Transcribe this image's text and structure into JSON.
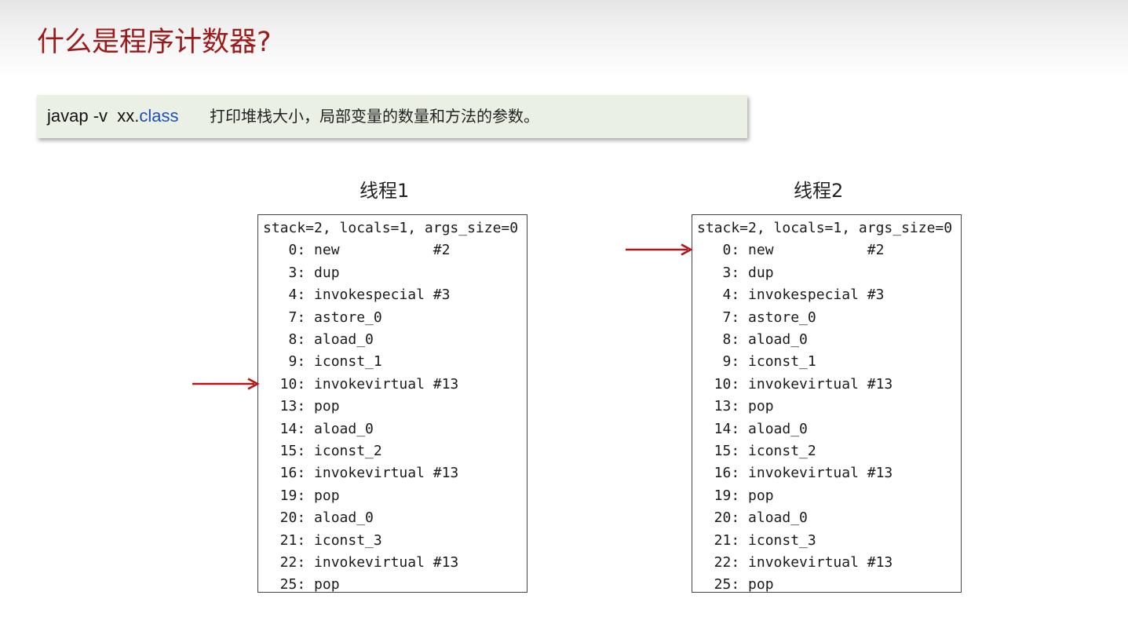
{
  "slide": {
    "title": "什么是程序计数器?"
  },
  "command": {
    "tool": "javap -v  xx.",
    "ext": "class",
    "description": "打印堆栈大小，局部变量的数量和方法的参数。"
  },
  "panels": [
    {
      "title": "线程1",
      "header": "stack=2, locals=1, args_size=0",
      "pointer_offset": "10",
      "lines": [
        {
          "offset": "0",
          "instr": "new           #2"
        },
        {
          "offset": "3",
          "instr": "dup"
        },
        {
          "offset": "4",
          "instr": "invokespecial #3"
        },
        {
          "offset": "7",
          "instr": "astore_0"
        },
        {
          "offset": "8",
          "instr": "aload_0"
        },
        {
          "offset": "9",
          "instr": "iconst_1"
        },
        {
          "offset": "10",
          "instr": "invokevirtual #13"
        },
        {
          "offset": "13",
          "instr": "pop"
        },
        {
          "offset": "14",
          "instr": "aload_0"
        },
        {
          "offset": "15",
          "instr": "iconst_2"
        },
        {
          "offset": "16",
          "instr": "invokevirtual #13"
        },
        {
          "offset": "19",
          "instr": "pop"
        },
        {
          "offset": "20",
          "instr": "aload_0"
        },
        {
          "offset": "21",
          "instr": "iconst_3"
        },
        {
          "offset": "22",
          "instr": "invokevirtual #13"
        },
        {
          "offset": "25",
          "instr": "pop"
        }
      ]
    },
    {
      "title": "线程2",
      "header": "stack=2, locals=1, args_size=0",
      "pointer_offset": "0",
      "lines": [
        {
          "offset": "0",
          "instr": "new           #2"
        },
        {
          "offset": "3",
          "instr": "dup"
        },
        {
          "offset": "4",
          "instr": "invokespecial #3"
        },
        {
          "offset": "7",
          "instr": "astore_0"
        },
        {
          "offset": "8",
          "instr": "aload_0"
        },
        {
          "offset": "9",
          "instr": "iconst_1"
        },
        {
          "offset": "10",
          "instr": "invokevirtual #13"
        },
        {
          "offset": "13",
          "instr": "pop"
        },
        {
          "offset": "14",
          "instr": "aload_0"
        },
        {
          "offset": "15",
          "instr": "iconst_2"
        },
        {
          "offset": "16",
          "instr": "invokevirtual #13"
        },
        {
          "offset": "19",
          "instr": "pop"
        },
        {
          "offset": "20",
          "instr": "aload_0"
        },
        {
          "offset": "21",
          "instr": "iconst_3"
        },
        {
          "offset": "22",
          "instr": "invokevirtual #13"
        },
        {
          "offset": "25",
          "instr": "pop"
        }
      ]
    }
  ],
  "colors": {
    "title": "#9b1b1b",
    "arrow": "#b01818",
    "command_bg": "#ebf0e4",
    "class_keyword": "#1f4fb5"
  }
}
